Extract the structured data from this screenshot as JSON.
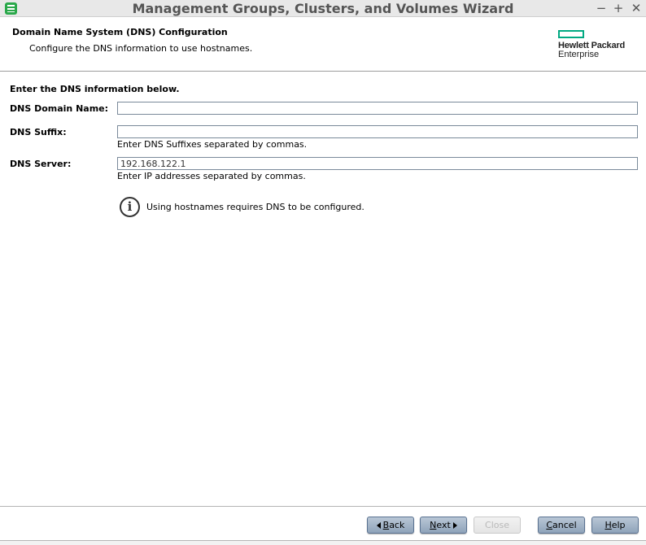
{
  "window": {
    "title": "Management Groups, Clusters, and Volumes Wizard",
    "icon": "storage-app-icon",
    "controls": {
      "minimize": "−",
      "maximize": "+",
      "close": "✕"
    }
  },
  "header": {
    "title": "Domain Name System (DNS) Configuration",
    "subtitle": "Configure the DNS information to use hostnames.",
    "logo": {
      "line1": "Hewlett Packard",
      "line2": "Enterprise",
      "brand_color": "#01a982"
    }
  },
  "form": {
    "intro": "Enter the DNS information below.",
    "domain_name": {
      "label": "DNS Domain Name:",
      "value": ""
    },
    "suffix": {
      "label": "DNS Suffix:",
      "value": "",
      "hint": "Enter DNS Suffixes separated by commas."
    },
    "server": {
      "label": "DNS Server:",
      "value": "192.168.122.1",
      "hint": "Enter IP addresses separated by commas."
    },
    "info": {
      "icon": "info-icon",
      "text": "Using hostnames requires DNS to be configured."
    }
  },
  "footer": {
    "back": {
      "label": "Back",
      "mnemonic": "B",
      "rest": "ack"
    },
    "next": {
      "label": "Next",
      "mnemonic": "N",
      "rest": "ext"
    },
    "close": {
      "label": "Close",
      "enabled": false
    },
    "cancel": {
      "label": "Cancel",
      "mnemonic": "C",
      "rest": "ancel"
    },
    "help": {
      "label": "Help",
      "mnemonic": "H",
      "rest": "elp"
    }
  }
}
